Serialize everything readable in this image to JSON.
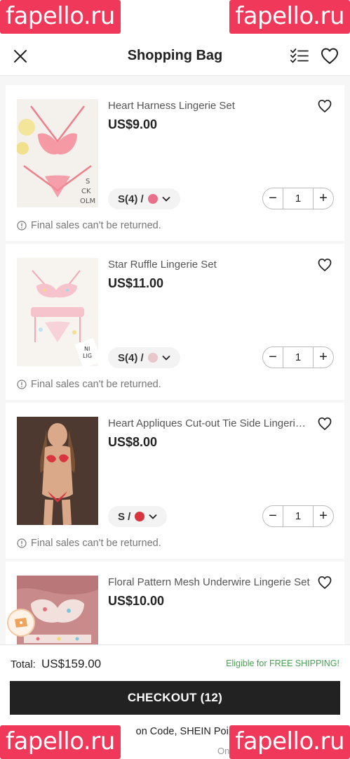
{
  "watermark": "fapello.ru",
  "header": {
    "title": "Shopping Bag"
  },
  "items": [
    {
      "name": "Heart Harness Lingerie Set",
      "price": "US$9.00",
      "variant": "S(4) /",
      "swatch": "#e9708a",
      "qty": "1",
      "notice": "Final sales can't be returned."
    },
    {
      "name": "Star Ruffle Lingerie Set",
      "price": "US$11.00",
      "variant": "S(4) /",
      "swatch": "#e9c6cc",
      "qty": "1",
      "notice": "Final sales can't be returned."
    },
    {
      "name": "Heart Appliques Cut-out Tie Side Lingerie Set",
      "price": "US$8.00",
      "variant": "S /",
      "swatch": "#d8353e",
      "qty": "1",
      "notice": "Final sales can't be returned."
    },
    {
      "name": "Floral Pattern Mesh Underwire Lingerie Set",
      "price": "US$10.00",
      "variant": "",
      "swatch": "#e8a9b0",
      "qty": "",
      "notice": ""
    }
  ],
  "footer": {
    "total_label": "Total:",
    "total_value": "US$159.00",
    "free_shipping": "Eligible for FREE SHIPPING!",
    "checkout_label": "CHECKOUT (12)",
    "promo_text": "on Code, SHEIN Points",
    "promo_suffix": "on",
    "promo_line2": "Onl"
  },
  "colors": {
    "accent_dark": "#222222",
    "watermark_bg": "#f0385a",
    "free_shipping": "#4a9e54"
  }
}
